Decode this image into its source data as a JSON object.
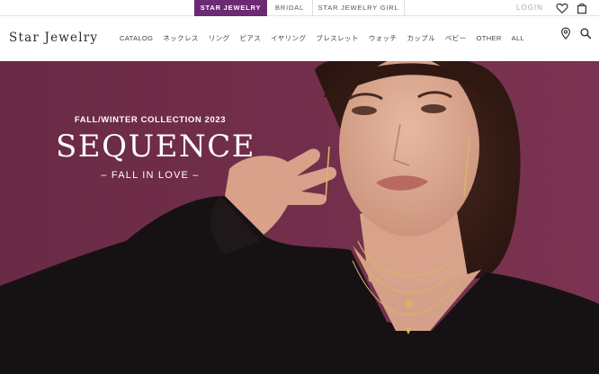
{
  "brand_tabs": [
    {
      "label": "STAR JEWELRY",
      "active": true
    },
    {
      "label": "BRIDAL",
      "active": false
    },
    {
      "label": "STAR JEWELRY GIRL",
      "active": false
    }
  ],
  "utility": {
    "login_label": "LOGIN",
    "icons": [
      "heart-icon",
      "shopping-bag-icon"
    ]
  },
  "header": {
    "logo": "Star Jewelry",
    "nav": [
      "CATALOG",
      "ネックレス",
      "リング",
      "ピアス",
      "イヤリング",
      "ブレスレット",
      "ウォッチ",
      "カップル",
      "ベビー",
      "OTHER",
      "ALL"
    ],
    "icons": [
      "location-pin-icon",
      "search-icon"
    ]
  },
  "hero": {
    "kicker": "FALL/WINTER COLLECTION 2023",
    "headline": "SEQUENCE",
    "tagline": "– FALL IN LOVE –"
  },
  "colors": {
    "brand_purple": "#6b2a73",
    "hero_background": "#6e2b48",
    "text": "#333333",
    "muted": "#aaaaaa"
  }
}
